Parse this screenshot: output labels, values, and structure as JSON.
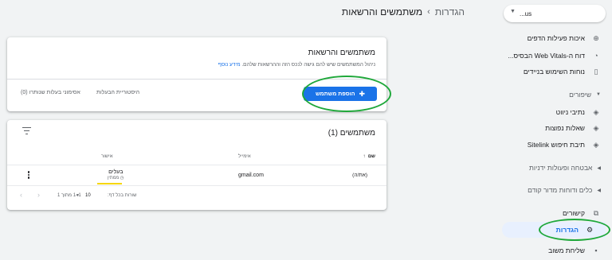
{
  "property": {
    "name": "us..."
  },
  "breadcrumb": {
    "root": "הגדרות",
    "separator": "›",
    "current": "משתמשים והרשאות"
  },
  "sidebar": {
    "items_top": [
      {
        "label": "איכות פעילות הדפים",
        "icon": "add-circle-icon"
      },
      {
        "label": "דוח ה-Web Vitals הבסיס...",
        "icon": "gauge-icon"
      },
      {
        "label": "נוחות השימוש בניידים",
        "icon": "phone-icon"
      }
    ],
    "enhancements": {
      "label": "שיפורים",
      "items": [
        {
          "label": "נתיבי ניווט",
          "icon": "layers-icon"
        },
        {
          "label": "שאלות נפוצות",
          "icon": "layers-icon"
        },
        {
          "label": "תיבת חיפוש Sitelink",
          "icon": "layers-icon"
        }
      ]
    },
    "security": {
      "label": "אבטחה ופעולות ידניות"
    },
    "legacy": {
      "label": "כלים ודוחות מדור קודם"
    },
    "links": {
      "label": "קישורים",
      "icon": "network-icon"
    },
    "settings": {
      "label": "הגדרות",
      "icon": "gear-icon"
    },
    "feedback": {
      "label": "שליחת משוב",
      "icon": "feedback-icon"
    }
  },
  "permissions_card": {
    "title": "משתמשים והרשאות",
    "description": "ניהול המשתמשים שיש להם גישה לנכס הזה וההרשאות שלהם.",
    "learn_more": "מידע נוסף",
    "add_user": "הוספת משתמש",
    "tab_history": "היסטוריית הבעלות",
    "tab_pending": "אסימוני בעלות שנותרו (0)"
  },
  "users_card": {
    "title": "משתמשים (1)",
    "columns": {
      "name": "שם",
      "email": "אימייל",
      "role": "אישור"
    },
    "rows": [
      {
        "name": "(את/ה)",
        "email": "gmail.com",
        "role": "בעלים",
        "status": "ממתין"
      }
    ],
    "pager": {
      "rows_per_page": "שורות בכל דף:",
      "page_size": "10",
      "range": "1–1 מתוך 1"
    }
  }
}
